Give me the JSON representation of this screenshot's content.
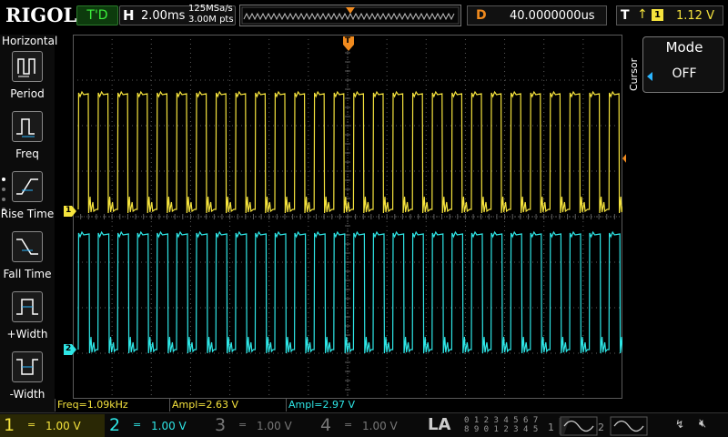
{
  "topbar": {
    "logo": "RIGOL",
    "run_status": "T'D",
    "horizontal_letter": "H",
    "timebase": "2.00ms",
    "sample_rate": "125MSa/s",
    "memory_depth": "3.00M pts",
    "delay_letter": "D",
    "delay_value": "40.0000000us",
    "trigger_letter": "T",
    "trigger_source": "1",
    "trigger_level": "1.12 V"
  },
  "left_menu": {
    "title": "Horizontal",
    "items": [
      {
        "label": "Period",
        "icon": "period-icon"
      },
      {
        "label": "Freq",
        "icon": "frequency-icon"
      },
      {
        "label": "Rise Time",
        "icon": "rise-time-icon"
      },
      {
        "label": "Fall Time",
        "icon": "fall-time-icon"
      },
      {
        "label": "+Width",
        "icon": "positive-width-icon"
      },
      {
        "label": "-Width",
        "icon": "negative-width-icon"
      }
    ]
  },
  "right_panel": {
    "vertical_label": "Cursor",
    "mode_label": "Mode",
    "mode_value": "OFF"
  },
  "measurements": [
    {
      "text": "Freq=1.09kHz"
    },
    {
      "text": "Ampl=2.63 V"
    },
    {
      "text": "Ampl=2.97 V"
    }
  ],
  "markers": {
    "ch1": "1",
    "ch2": "2",
    "trigger_pos": "T",
    "trigger_level": "T"
  },
  "channels": [
    {
      "num": "1",
      "coupling": "=",
      "scale": "1.00 V",
      "color": "#f5e33d",
      "active": true
    },
    {
      "num": "2",
      "coupling": "=",
      "scale": "1.00 V",
      "color": "#2ee6e6",
      "active": true
    },
    {
      "num": "3",
      "coupling": "=",
      "scale": "1.00 V",
      "color": "#777777",
      "active": false
    },
    {
      "num": "4",
      "coupling": "=",
      "scale": "1.00 V",
      "color": "#777777",
      "active": false
    }
  ],
  "logic_analyzer": {
    "label": "LA",
    "row1": "0 1 2 3  4 5 6 7",
    "row2": "8 9 0 1  2 3 4 5"
  },
  "generators": [
    {
      "num": "1"
    },
    {
      "num": "2"
    }
  ],
  "colors": {
    "ch1": "#f5e33d",
    "ch2": "#2ee6e6",
    "trigger": "#f08a1e",
    "grid": "#5a5a5a"
  }
}
